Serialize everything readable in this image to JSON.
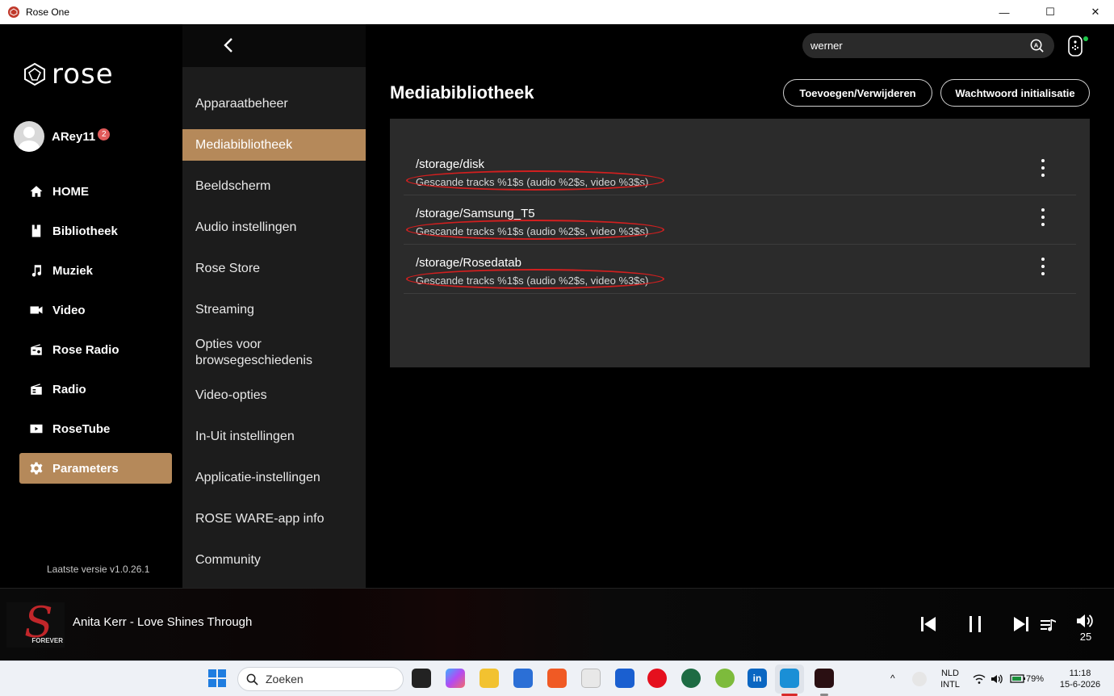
{
  "window": {
    "title": "Rose One",
    "minimize": "—",
    "maximize": "☐",
    "close": "✕"
  },
  "sidebar": {
    "logo_text": "rose",
    "user": {
      "name": "ARey11",
      "badge": "2"
    },
    "items": [
      {
        "label": "HOME",
        "icon": "home-icon"
      },
      {
        "label": "Bibliotheek",
        "icon": "library-icon"
      },
      {
        "label": "Muziek",
        "icon": "music-note-icon"
      },
      {
        "label": "Video",
        "icon": "video-camera-icon"
      },
      {
        "label": "Rose Radio",
        "icon": "radio-icon"
      },
      {
        "label": "Radio",
        "icon": "radio-icon"
      },
      {
        "label": "RoseTube",
        "icon": "play-icon"
      },
      {
        "label": "Parameters",
        "icon": "gear-icon",
        "active": true
      }
    ],
    "version": "Laatste versie v1.0.26.1"
  },
  "settings_menu": {
    "items": [
      "Apparaatbeheer",
      "Mediabibliotheek",
      "Beeldscherm",
      "Audio instellingen",
      "Rose Store",
      "Streaming",
      "Opties voor browsegeschiedenis",
      "Video-opties",
      "In-Uit instellingen",
      "Applicatie-instellingen",
      "ROSE WARE-app info",
      "Community"
    ],
    "active": "Mediabibliotheek"
  },
  "search": {
    "value": "werner"
  },
  "main": {
    "title": "Mediabibliotheek",
    "buttons": {
      "add_remove": "Toevoegen/Verwijderen",
      "password_init": "Wachtwoord initialisatie"
    },
    "storages": [
      {
        "path": "/storage/disk",
        "status": "Gescande tracks %1$s (audio %2$s, video %3$s)"
      },
      {
        "path": "/storage/Samsung_T5",
        "status": "Gescande tracks %1$s (audio %2$s, video %3$s)"
      },
      {
        "path": "/storage/Rosedatab",
        "status": "Gescande tracks %1$s (audio %2$s, video %3$s)"
      }
    ]
  },
  "player": {
    "track": "Anita Kerr - Love Shines Through",
    "album_text": "FOREVER",
    "volume": "25"
  },
  "taskbar": {
    "search_placeholder": "Zoeken",
    "lang_top": "NLD",
    "lang_bottom": "INTL",
    "battery": "79%",
    "time": "11:18",
    "date": "15-6-2026"
  },
  "colors": {
    "accent": "#b5895a",
    "annotation": "#d21f1f",
    "panel": "#2b2b2b"
  }
}
